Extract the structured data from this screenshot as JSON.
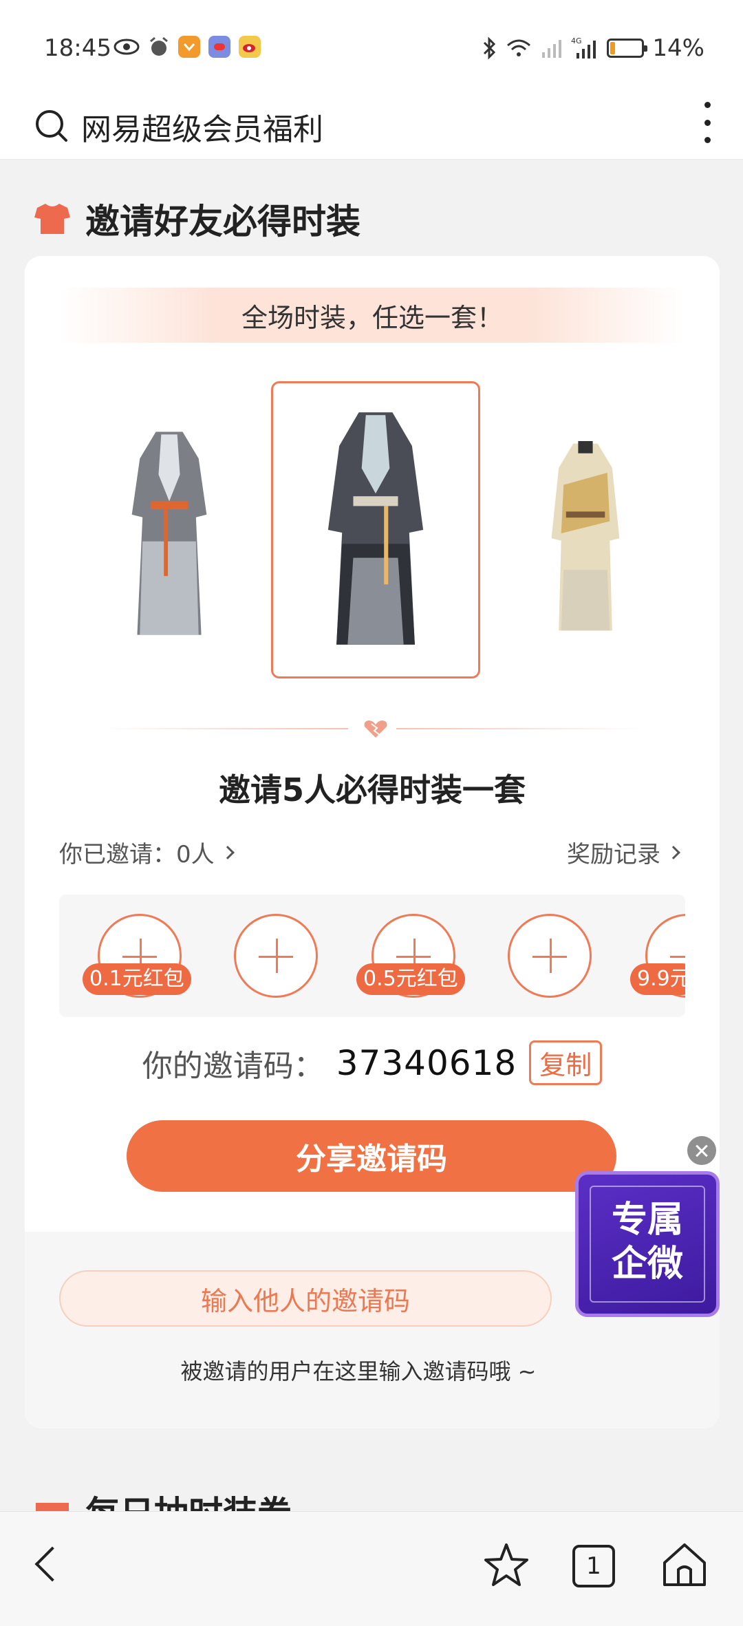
{
  "status_bar": {
    "time": "18:45",
    "battery": "14%",
    "battery_level": 0.14,
    "network": "4G"
  },
  "search": {
    "query": "网易超级会员福利"
  },
  "section": {
    "title": "邀请好友必得时装"
  },
  "card": {
    "banner": "全场时装，任选一套！",
    "invite_title": "邀请5人必得时装一套",
    "invited_count": "你已邀请：0人",
    "reward_record": "奖励记录",
    "slots": [
      {
        "badge": "0.1元红包"
      },
      {
        "badge": ""
      },
      {
        "badge": "0.5元红包"
      },
      {
        "badge": ""
      },
      {
        "badge": "9.9元"
      }
    ],
    "code_label": "你的邀请码：",
    "code_value": "37340618",
    "copy_label": "复制",
    "share_label": "分享邀请码",
    "enter_code_label": "输入他人的邀请码",
    "hint": "被邀请的用户在这里输入邀请码哦 ~"
  },
  "promo": {
    "text_line1": "专属",
    "text_line2": "企微"
  },
  "next_section": {
    "title": "每日抽时装券"
  },
  "bottom_nav": {
    "tab_count": "1"
  },
  "colors": {
    "accent": "#ef7144",
    "accent_light": "#fdeee7",
    "promo_bg": "#4a23b3"
  }
}
